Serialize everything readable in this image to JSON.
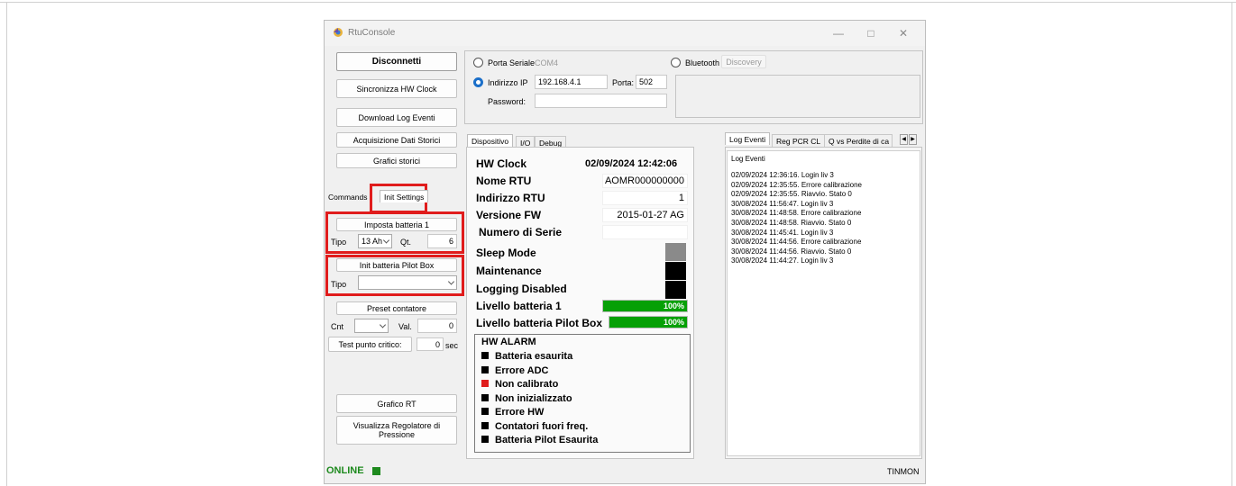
{
  "window": {
    "title": "RtuConsole"
  },
  "left_buttons": {
    "disconnect": "Disconnetti",
    "sync_clock": "Sincronizza HW Clock",
    "download_log": "Download Log Eventi",
    "historic_data": "Acquisizione Dati Storici",
    "historic_charts": "Grafici storici",
    "rt_chart": "Grafico RT",
    "pressure_regulator": "Visualizza Regolatore di Pressione"
  },
  "left_tabs": {
    "commands": "Commands",
    "init_settings": "Init Settings"
  },
  "battery": {
    "set_button": "Imposta batteria 1",
    "type_label": "Tipo",
    "type_value": "13 Ah",
    "qty_label": "Qt.",
    "qty_value": "6"
  },
  "pilot": {
    "init_button": "Init batteria Pilot Box",
    "type_label": "Tipo",
    "type_value": ""
  },
  "counter": {
    "preset_button": "Preset contatore",
    "cnt_label": "Cnt",
    "cnt_value": "",
    "val_label": "Val.",
    "val_value": "0",
    "test_button": "Test punto critico:",
    "test_value": "0",
    "test_unit": "sec"
  },
  "connection": {
    "serial_label": "Porta Seriale",
    "serial_port": "COM4",
    "bluetooth_label": "Bluetooth",
    "discovery": "Discovery",
    "ip_label": "Indirizzo IP",
    "ip_value": "192.168.4.1",
    "port_label": "Porta:",
    "port_value": "502",
    "password_label": "Password:",
    "password_value": ""
  },
  "center_tabs": [
    "Dispositivo",
    "I/O",
    "Debug"
  ],
  "device": {
    "hw_clock_label": "HW Clock",
    "hw_clock_value": "02/09/2024 12:42:06",
    "rtu_name_label": "Nome RTU",
    "rtu_name_value": "AOMR000000000",
    "rtu_address_label": "Indirizzo RTU",
    "rtu_address_value": "1",
    "fw_label": "Versione FW",
    "fw_value": "2015-01-27 AG",
    "serial_label": "Numero di Serie",
    "serial_value": "",
    "sleep_label": "Sleep Mode",
    "maintenance_label": "Maintenance",
    "logging_label": "Logging Disabled",
    "battery1_label": "Livello batteria 1",
    "battery1_level": 100,
    "battery1_text": "100%",
    "pilot_label": "Livello batteria Pilot Box",
    "pilot_level": 100,
    "pilot_text": "100%"
  },
  "alarms": {
    "title": "HW ALARM",
    "items": [
      {
        "label": "Batteria esaurita",
        "color": "#000000"
      },
      {
        "label": "Errore ADC",
        "color": "#000000"
      },
      {
        "label": "Non calibrato",
        "color": "#e01c1c"
      },
      {
        "label": "Non inizializzato",
        "color": "#000000"
      },
      {
        "label": "Errore HW",
        "color": "#000000"
      },
      {
        "label": "Contatori fuori freq.",
        "color": "#000000"
      },
      {
        "label": "Batteria Pilot Esaurita",
        "color": "#000000"
      }
    ]
  },
  "right_tabs": [
    "Log Eventi",
    "Reg PCR CL",
    "Q vs Perdite di ca"
  ],
  "log": {
    "header": "Log Eventi",
    "lines": [
      "02/09/2024 12:36:16. Login liv 3",
      "02/09/2024 12:35:55. Errore calibrazione",
      "02/09/2024 12:35:55. Riavvio. Stato 0",
      "30/08/2024 11:56:47. Login liv 3",
      "30/08/2024 11:48:58. Errore calibrazione",
      "30/08/2024 11:48:58. Riavvio. Stato 0",
      "30/08/2024 11:45:41. Login liv 3",
      "30/08/2024 11:44:56. Errore calibrazione",
      "30/08/2024 11:44:56. Riavvio. Stato 0",
      "30/08/2024 11:44:27. Login liv 3"
    ]
  },
  "status": {
    "online": "ONLINE",
    "online_color": "#1e8a1e",
    "right": "TINMON"
  }
}
